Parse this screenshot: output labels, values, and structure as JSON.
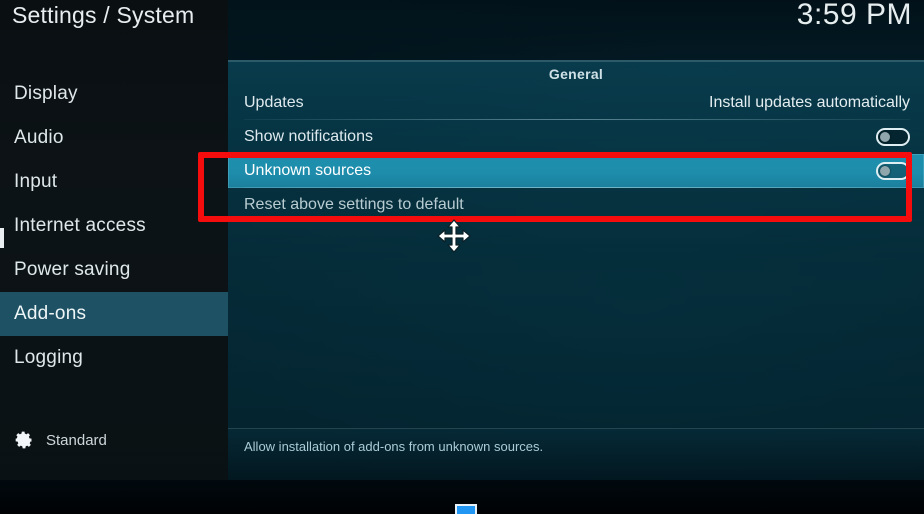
{
  "window": {
    "title": "Settings / System",
    "clock": "3:59 PM"
  },
  "sidebar": {
    "items": [
      {
        "label": "Display",
        "selected": false
      },
      {
        "label": "Audio",
        "selected": false
      },
      {
        "label": "Input",
        "selected": false
      },
      {
        "label": "Internet access",
        "selected": false
      },
      {
        "label": "Power saving",
        "selected": false
      },
      {
        "label": "Add-ons",
        "selected": true
      },
      {
        "label": "Logging",
        "selected": false
      }
    ],
    "footer": {
      "icon": "gear-icon",
      "label": "Standard"
    }
  },
  "main": {
    "group_title": "General",
    "rows": [
      {
        "label": "Updates",
        "value": "Install updates automatically",
        "control": "text",
        "highlighted": false
      },
      {
        "label": "Show notifications",
        "value": "",
        "control": "toggle",
        "toggle_on": false,
        "highlighted": false
      },
      {
        "label": "Unknown sources",
        "value": "",
        "control": "toggle",
        "toggle_on": false,
        "highlighted": true
      },
      {
        "label": "Reset above settings to default",
        "value": "",
        "control": "none",
        "highlighted": false
      }
    ],
    "description": "Allow installation of add-ons from unknown sources."
  },
  "annotation": {
    "shape": "rectangle",
    "color": "#f50d0d"
  },
  "cursor": {
    "icon": "move-cursor-icon"
  },
  "colors": {
    "accent_highlight": "#1f8fae",
    "sidebar_selected": "#1d5163",
    "annotation_red": "#f50d0d",
    "panel_bg": "#094052",
    "text_primary": "#dfeaee",
    "text_muted": "#a9ccd6",
    "bottom_chip": "#2196f3"
  }
}
